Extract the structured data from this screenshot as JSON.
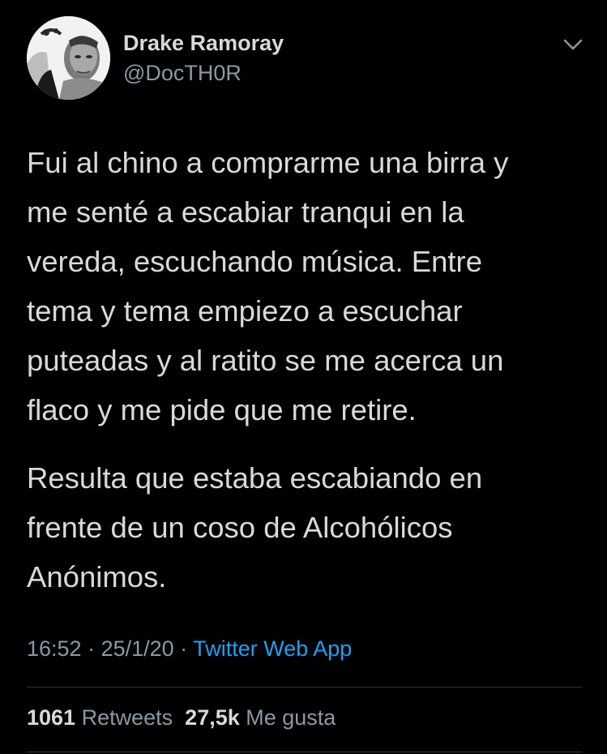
{
  "author": {
    "display_name": "Drake Ramoray",
    "handle": "@DocTH0R",
    "avatar_icon": "profile-photo-bw"
  },
  "tweet": {
    "paragraph_1": [
      "Fui al chino a comprarme una birra y",
      "me senté a escabiar tranqui en la",
      "vereda, escuchando música. Entre",
      "tema y tema empiezo a escuchar",
      "puteadas y al ratito se me acerca un",
      "flaco y me pide que me retire."
    ],
    "paragraph_2": [
      "Resulta que estaba escabiando en",
      "frente de un coso de Alcohólicos",
      "Anónimos."
    ]
  },
  "meta": {
    "time": "16:52",
    "sep1": " · ",
    "date": "25/1/20",
    "sep2": " · ",
    "source": "Twitter Web App"
  },
  "stats": {
    "retweets_count": "1061",
    "retweets_label": "Retweets",
    "likes_count": "27,5k",
    "likes_label": "Me gusta"
  },
  "colors": {
    "background": "#000000",
    "text": "#d9d9d9",
    "secondary": "#8b98a5",
    "link": "#1da1f2",
    "divider": "#2f3336"
  }
}
